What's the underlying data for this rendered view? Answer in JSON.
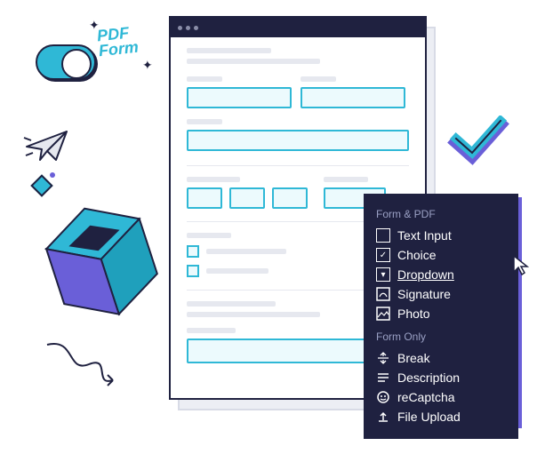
{
  "decor": {
    "pdf_line1": "PDF",
    "pdf_line2": "Form"
  },
  "menu": {
    "section1_header": "Form & PDF",
    "section1_items": [
      {
        "icon": "text-input-icon",
        "label": "Text Input"
      },
      {
        "icon": "choice-icon",
        "label": "Choice"
      },
      {
        "icon": "dropdown-icon",
        "label": "Dropdown",
        "hover": true
      },
      {
        "icon": "signature-icon",
        "label": "Signature"
      },
      {
        "icon": "photo-icon",
        "label": "Photo"
      }
    ],
    "section2_header": "Form Only",
    "section2_items": [
      {
        "icon": "break-icon",
        "label": "Break"
      },
      {
        "icon": "description-icon",
        "label": "Description"
      },
      {
        "icon": "recaptcha-icon",
        "label": "reCaptcha"
      },
      {
        "icon": "file-upload-icon",
        "label": "File Upload"
      }
    ]
  }
}
